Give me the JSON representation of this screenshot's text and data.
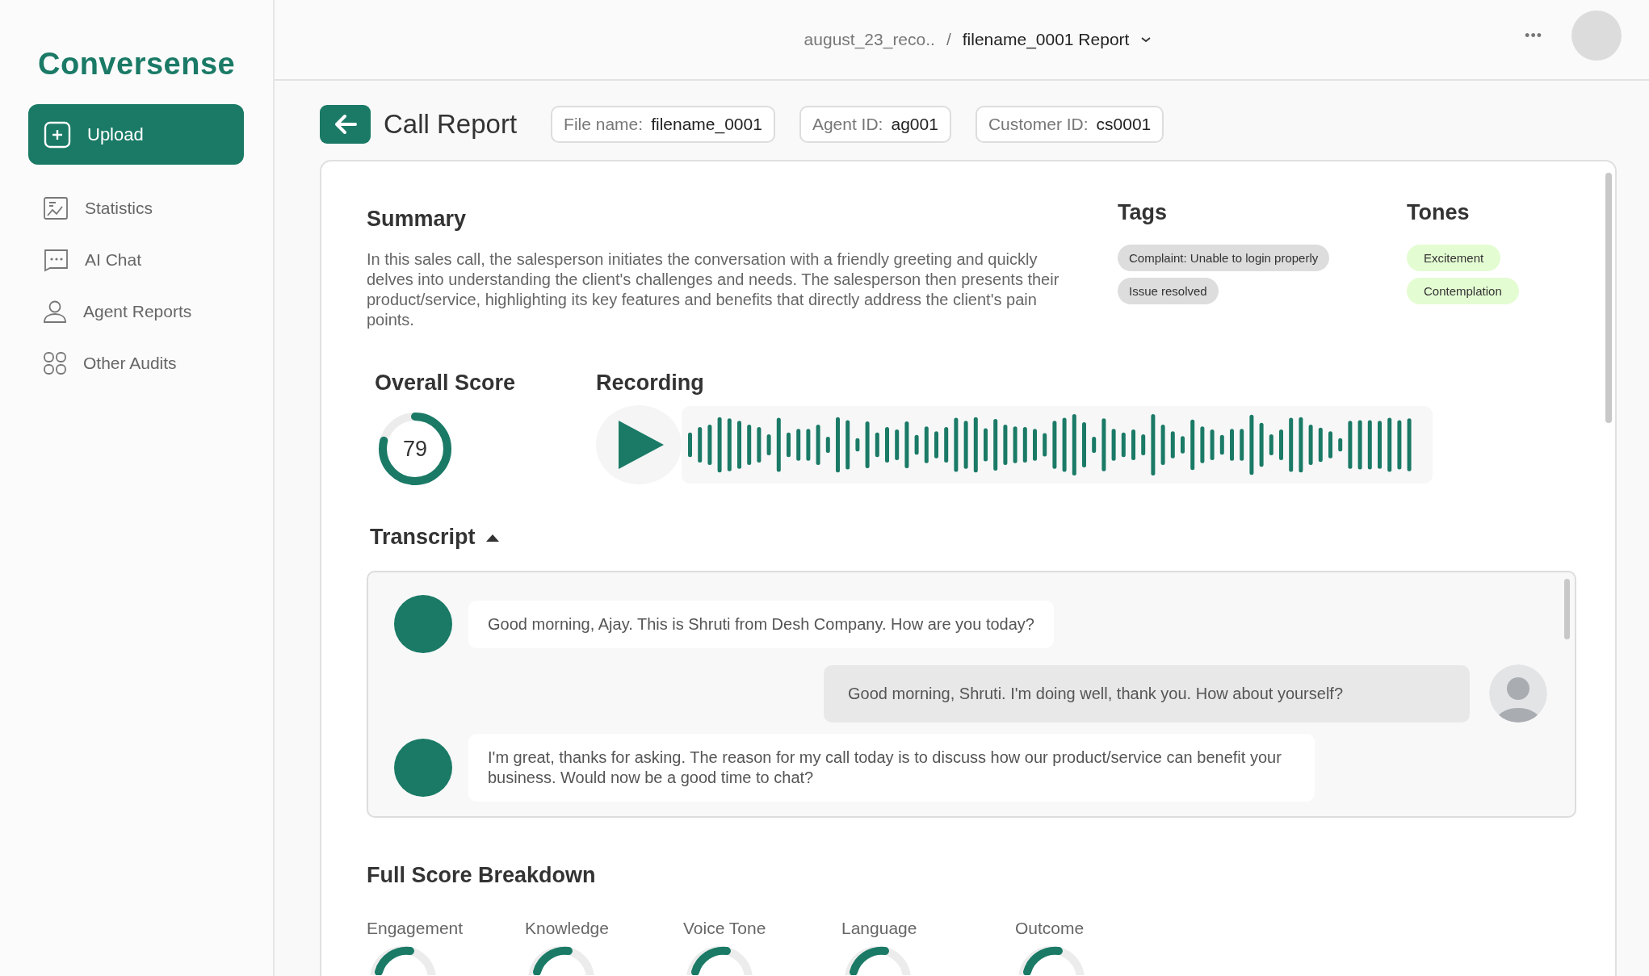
{
  "sidebar": {
    "logo": "Conversense",
    "upload": {
      "label": "Upload"
    },
    "items": [
      {
        "label": "Statistics",
        "kind": "chart",
        "selected": false
      },
      {
        "label": "AI Chat",
        "kind": "chat",
        "selected": false
      },
      {
        "label": "Agent Reports",
        "kind": "person",
        "selected": false
      },
      {
        "label": "Other Audits",
        "kind": "grid",
        "selected": false
      }
    ]
  },
  "header": {
    "breadcrumb": [
      "august_23_reco..",
      "/",
      "filename_0001 Report"
    ],
    "more": "•••"
  },
  "report": {
    "title": "Call Report",
    "fields": [
      {
        "label": "File name:",
        "value": "filename_0001"
      },
      {
        "label": "Agent ID:",
        "value": "ag001"
      },
      {
        "label": "Customer ID:",
        "value": "cs0001"
      }
    ]
  },
  "summary": {
    "title": "Summary",
    "text": "In this sales call, the salesperson initiates the conversation with a friendly greeting and quickly delves into understanding the client's challenges and needs. The salesperson then presents their product/service, highlighting its key features and benefits that directly address the client's pain points."
  },
  "tags": {
    "title": "Tags",
    "items": [
      "Complaint: Unable to login properly",
      "Issue resolved"
    ]
  },
  "tones": {
    "title": "Tones",
    "items": [
      "Excitement",
      "Contemplation"
    ]
  },
  "overall_score": {
    "title": "Overall Score",
    "value": "79",
    "level": 0.79
  },
  "recording": {
    "title": "Recording"
  },
  "transcript": {
    "title": "Transcript",
    "expanded": true,
    "messages": [
      {
        "kind": "agent",
        "text": "Good morning, Ajay. This is Shruti from Desh Company. How are you today?"
      },
      {
        "kind": "customer",
        "text": "Good morning, Shruti. I'm doing well, thank you. How about yourself?"
      },
      {
        "kind": "agent",
        "text": "I'm great, thanks for asking. The reason for my call today is to  discuss how our product/service can benefit your business. Would now be a  good time to chat?"
      }
    ]
  },
  "breakdown": {
    "title": "Full Score Breakdown",
    "items": [
      "Engagement",
      "Knowledge",
      "Voice Tone",
      "Language",
      "Outcome"
    ]
  }
}
